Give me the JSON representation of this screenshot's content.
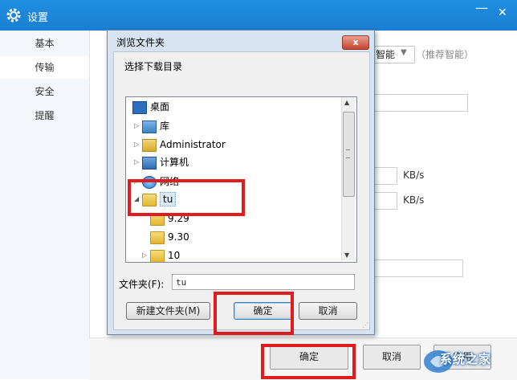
{
  "window": {
    "title": "设置",
    "minimize": "—",
    "close": "✕"
  },
  "sidebar": {
    "items": [
      {
        "label": "基本",
        "active": false
      },
      {
        "label": "传输",
        "active": true
      },
      {
        "label": "安全",
        "active": false
      },
      {
        "label": "提醒",
        "active": false
      }
    ]
  },
  "settings": {
    "mode_value": "智能",
    "mode_hint": "（推荐智能）",
    "speed_unit_1": "KB/s",
    "speed_unit_2": "KB/s"
  },
  "dialog": {
    "title": "浏览文件夹",
    "close": "x",
    "prompt": "选择下载目录",
    "tree": [
      {
        "label": "桌面",
        "icon": "desktop-icon"
      },
      {
        "label": "库",
        "icon": "library-icon"
      },
      {
        "label": "Administrator",
        "icon": "user-folder-icon"
      },
      {
        "label": "计算机",
        "icon": "computer-icon"
      },
      {
        "label": "网络",
        "icon": "network-icon"
      },
      {
        "label": "tu",
        "icon": "folder-icon",
        "selected": true
      },
      {
        "label": "9.29",
        "icon": "folder-icon"
      },
      {
        "label": "9.30",
        "icon": "folder-icon"
      },
      {
        "label": "10",
        "icon": "folder-icon"
      }
    ],
    "folder_label": "文件夹(F):",
    "folder_value": "tu",
    "new_folder_button": "新建文件夹(M)",
    "ok_button": "确定",
    "cancel_button": "取消"
  },
  "footer": {
    "ok_button": "确定",
    "cancel_button": "取消",
    "apply_button": "应用",
    "watermark": "系统之家"
  },
  "colors": {
    "accent": "#1a87db",
    "highlight": "#e11c1c"
  }
}
